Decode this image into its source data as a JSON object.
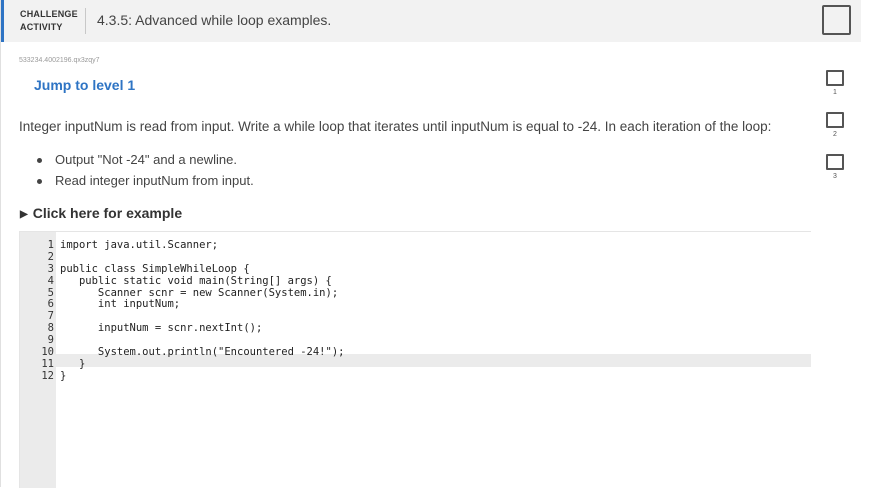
{
  "header": {
    "label_line1": "CHALLENGE",
    "label_line2": "ACTIVITY",
    "title": "4.3.5: Advanced while loop examples."
  },
  "activity_id": "533234.4002196.qx3zqy7",
  "jump_link": "Jump to level 1",
  "prompt": "Integer inputNum is read from input. Write a while loop that iterates until inputNum is equal to -24. In each iteration of the loop:",
  "bullets": [
    "Output \"Not -24\" and a newline.",
    "Read integer inputNum from input."
  ],
  "example_toggle": "Click here for example",
  "code": {
    "line_numbers": [
      "1",
      "2",
      "3",
      "4",
      "5",
      "6",
      "7",
      "8",
      "9",
      "10",
      "11",
      "12"
    ],
    "lines": [
      "import java.util.Scanner;",
      "",
      "public class SimpleWhileLoop {",
      "   public static void main(String[] args) {",
      "      Scanner scnr = new Scanner(System.in);",
      "      int inputNum;",
      "",
      "      inputNum = scnr.nextInt();",
      "",
      "      System.out.println(\"Encountered -24!\");",
      "   }",
      "}"
    ]
  },
  "levels": [
    "1",
    "2",
    "3"
  ],
  "colors": {
    "accent": "#2e74c4",
    "header_bg": "#f2f2f2",
    "gutter_bg": "#ebebeb"
  }
}
